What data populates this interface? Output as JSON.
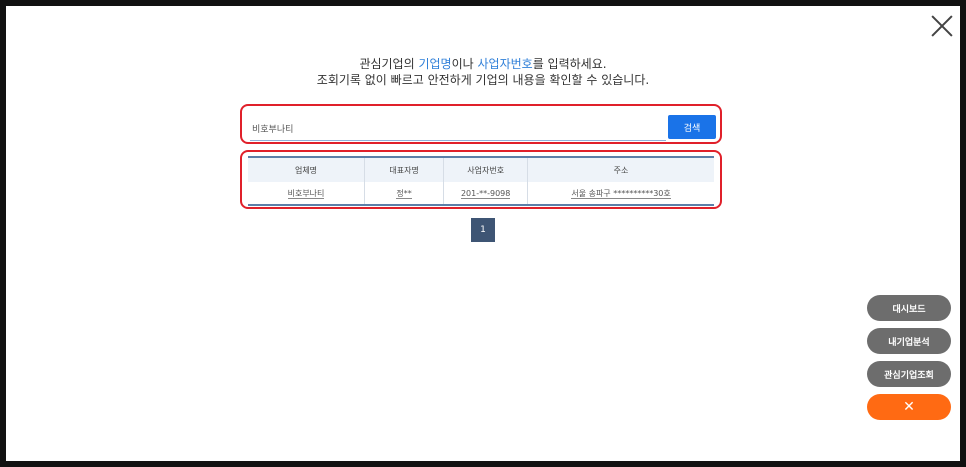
{
  "intro": {
    "line1_a": "관심기업의 ",
    "line1_b": "기업명",
    "line1_c": "이나 ",
    "line1_d": "사업자번호",
    "line1_e": "를 입력하세요.",
    "line2": "조회기록 없이 빠르고 안전하게 기업의 내용을 확인할 수 있습니다."
  },
  "search": {
    "value": "비호부나티",
    "button": "검색"
  },
  "table": {
    "headers": [
      "업체명",
      "대표자명",
      "사업자번호",
      "주소"
    ],
    "rows": [
      [
        "비호부나티",
        "정**",
        "201-**-9098",
        "서울 송파구 **********30호"
      ]
    ]
  },
  "pagination": {
    "current": "1"
  },
  "side": {
    "dashboard": "대시보드",
    "my_analysis": "내기업분석",
    "interest_lookup": "관심기업조회",
    "close": "✕"
  },
  "colors": {
    "accent": "#1a73e8",
    "highlight": "#e0202a",
    "orange": "#ff6a13"
  }
}
